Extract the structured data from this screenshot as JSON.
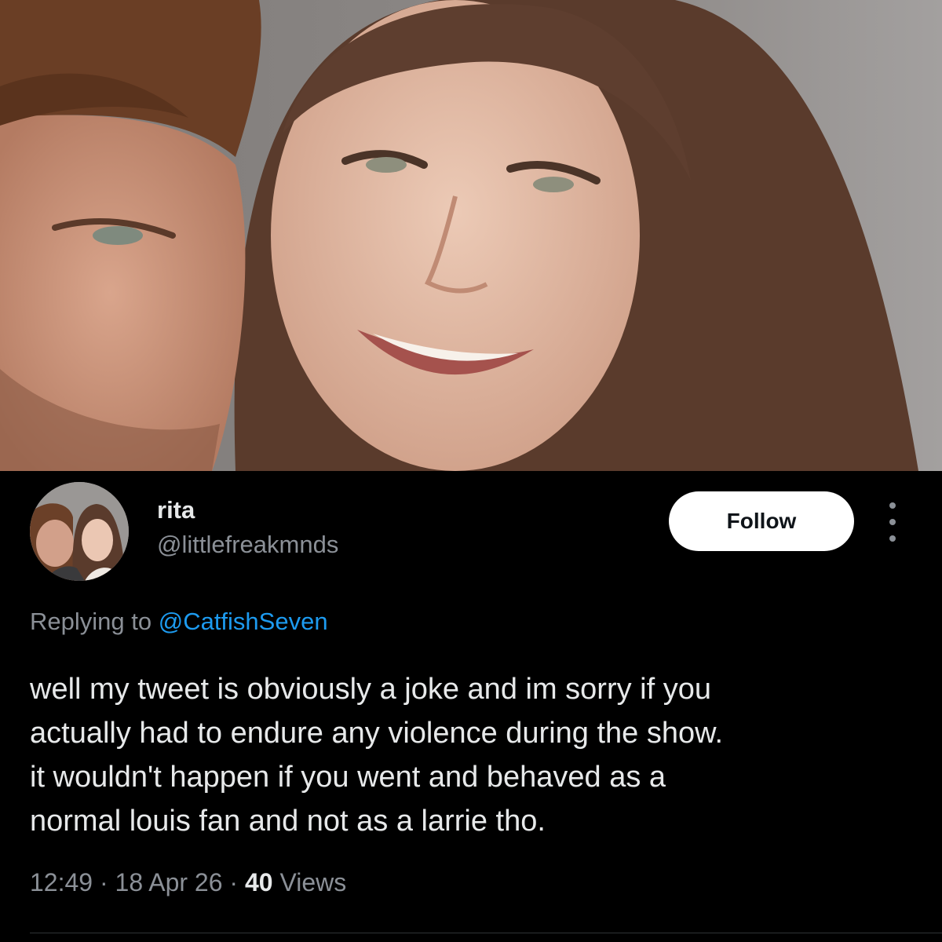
{
  "photo": {
    "description_icon": "photo-image"
  },
  "tweet": {
    "author": {
      "display_name": "rita",
      "handle": "@littlefreakmnds"
    },
    "follow_label": "Follow",
    "more_icon": "more-vertical-icon",
    "replying_prefix": "Replying to",
    "replying_to": "@CatfishSeven",
    "text": "well my tweet is obviously a joke and im sorry if you\nactually had to endure any violence during the show.\nit wouldn't happen if you went and behaved as a\nnormal louis fan and not as a larrie tho.",
    "time": "12:49",
    "separator": "·",
    "date": "18 Apr 26",
    "views_count": "40",
    "views_label": "Views"
  },
  "colors": {
    "background": "#000000",
    "text_primary": "#e7e9ea",
    "text_secondary": "#8b9097",
    "link": "#1d9bf0",
    "button_bg": "#ffffff",
    "button_text": "#0f1419"
  }
}
